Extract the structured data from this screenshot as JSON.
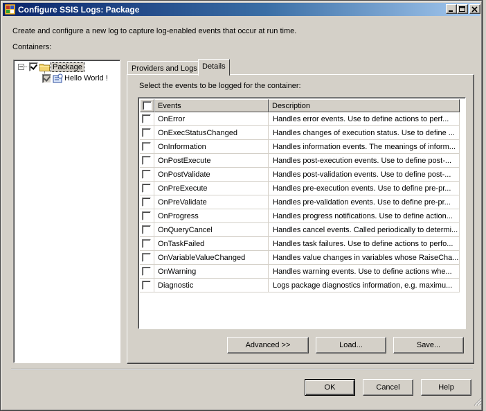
{
  "window": {
    "title": "Configure SSIS Logs: Package"
  },
  "intro_text": "Create and configure a new log to capture log-enabled events that occur at run time.",
  "containers_label": "Containers:",
  "tree": {
    "root": {
      "label": "Package",
      "checked": true,
      "expanded": true
    },
    "child": {
      "label": "Hello World !",
      "checked": true
    }
  },
  "tabs": [
    {
      "label": "Providers and Logs",
      "active": false
    },
    {
      "label": "Details",
      "active": true
    }
  ],
  "details": {
    "prompt": "Select the events to be logged for the container:",
    "columns": {
      "events": "Events",
      "description": "Description"
    },
    "rows": [
      {
        "event": "OnError",
        "description": "Handles error events. Use to define actions to perf...",
        "checked": false
      },
      {
        "event": "OnExecStatusChanged",
        "description": "Handles changes of execution status. Use to define ...",
        "checked": false
      },
      {
        "event": "OnInformation",
        "description": "Handles information events. The meanings of inform...",
        "checked": false
      },
      {
        "event": "OnPostExecute",
        "description": "Handles post-execution events. Use to define post-...",
        "checked": false
      },
      {
        "event": "OnPostValidate",
        "description": "Handles post-validation events. Use to define post-...",
        "checked": false
      },
      {
        "event": "OnPreExecute",
        "description": "Handles pre-execution events. Use to define pre-pr...",
        "checked": false
      },
      {
        "event": "OnPreValidate",
        "description": "Handles pre-validation events. Use to define pre-pr...",
        "checked": false
      },
      {
        "event": "OnProgress",
        "description": "Handles progress notifications. Use to define action...",
        "checked": false
      },
      {
        "event": "OnQueryCancel",
        "description": "Handles cancel events. Called periodically to determi...",
        "checked": false
      },
      {
        "event": "OnTaskFailed",
        "description": "Handles task failures. Use to define actions to perfo...",
        "checked": false
      },
      {
        "event": "OnVariableValueChanged",
        "description": "Handles value changes in variables whose RaiseCha...",
        "checked": false
      },
      {
        "event": "OnWarning",
        "description": "Handles warning events. Use to define actions whe...",
        "checked": false
      },
      {
        "event": "Diagnostic",
        "description": "Logs package diagnostics information, e.g. maximu...",
        "checked": false
      }
    ],
    "buttons": {
      "advanced": "Advanced >>",
      "load": "Load...",
      "save": "Save..."
    }
  },
  "footer": {
    "ok": "OK",
    "cancel": "Cancel",
    "help": "Help"
  },
  "colors": {
    "titlebar_start": "#0a246a",
    "titlebar_end": "#a6caf0",
    "face": "#d4d0c8"
  }
}
